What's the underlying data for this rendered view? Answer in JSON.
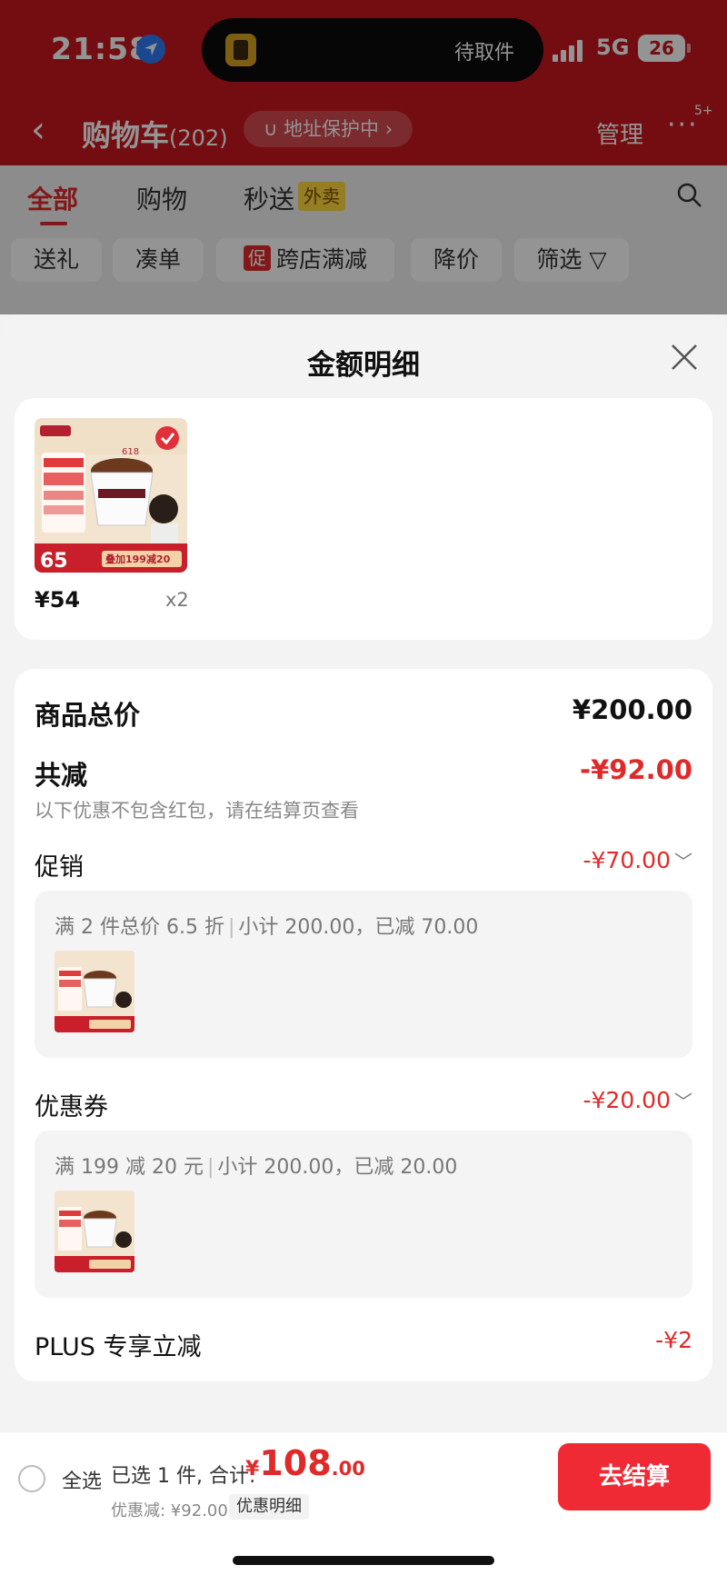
{
  "status": {
    "time": "21:58",
    "island_text": "待取件",
    "network": "5G",
    "battery": "26"
  },
  "nav": {
    "back": "‹",
    "title": "购物车",
    "count": "(202)",
    "address_pill": "∪ 地址保护中 ›",
    "manage": "管理",
    "more": "···",
    "more_badge": "5+"
  },
  "tabs": [
    {
      "label": "全部",
      "active": true
    },
    {
      "label": "购物",
      "active": false
    },
    {
      "label": "秒送",
      "active": false
    }
  ],
  "tab_tag": "外卖",
  "chips": {
    "gift": "送礼",
    "bundle": "凑单",
    "promo_tag": "促",
    "cross_store": "跨店满减",
    "price_drop": "降价",
    "filter": "筛选 ▽"
  },
  "sheet": {
    "title": "金额明细",
    "close_icon": "close-icon",
    "product": {
      "price": "¥54",
      "qty": "x2",
      "img_badge_618": "618",
      "img_price": "65",
      "img_promo": "叠加199减20"
    },
    "total_label": "商品总价",
    "total_value": "¥200.00",
    "discount_label": "共减",
    "discount_value": "-¥92.00",
    "note": "以下优惠不包含红包，请在结算页查看",
    "promo_label": "促销",
    "promo_value": "-¥70.00",
    "promo_detail_a": "满 2 件总价 6.5 折",
    "promo_detail_b": "小计 200.00，已减 70.00",
    "coupon_label": "优惠券",
    "coupon_value": "-¥20.00",
    "coupon_detail_a": "满 199 减 20 元",
    "coupon_detail_b": "小计 200.00，已减 20.00",
    "plus_label": "PLUS 专享立减",
    "plus_value": "-¥2",
    "chevron": "﹀"
  },
  "bottom": {
    "select_all": "全选",
    "selected": "已选 1 件, 合计:",
    "currency": "¥",
    "total_int": "108",
    "total_dec": ".00",
    "discount_text": "优惠减: ¥92.00",
    "discount_detail_btn": "优惠明细",
    "checkout": "去结算"
  },
  "colors": {
    "brand_red": "#c8171e",
    "accent_red": "#e02a2a",
    "checkout_red": "#ef2a35"
  }
}
